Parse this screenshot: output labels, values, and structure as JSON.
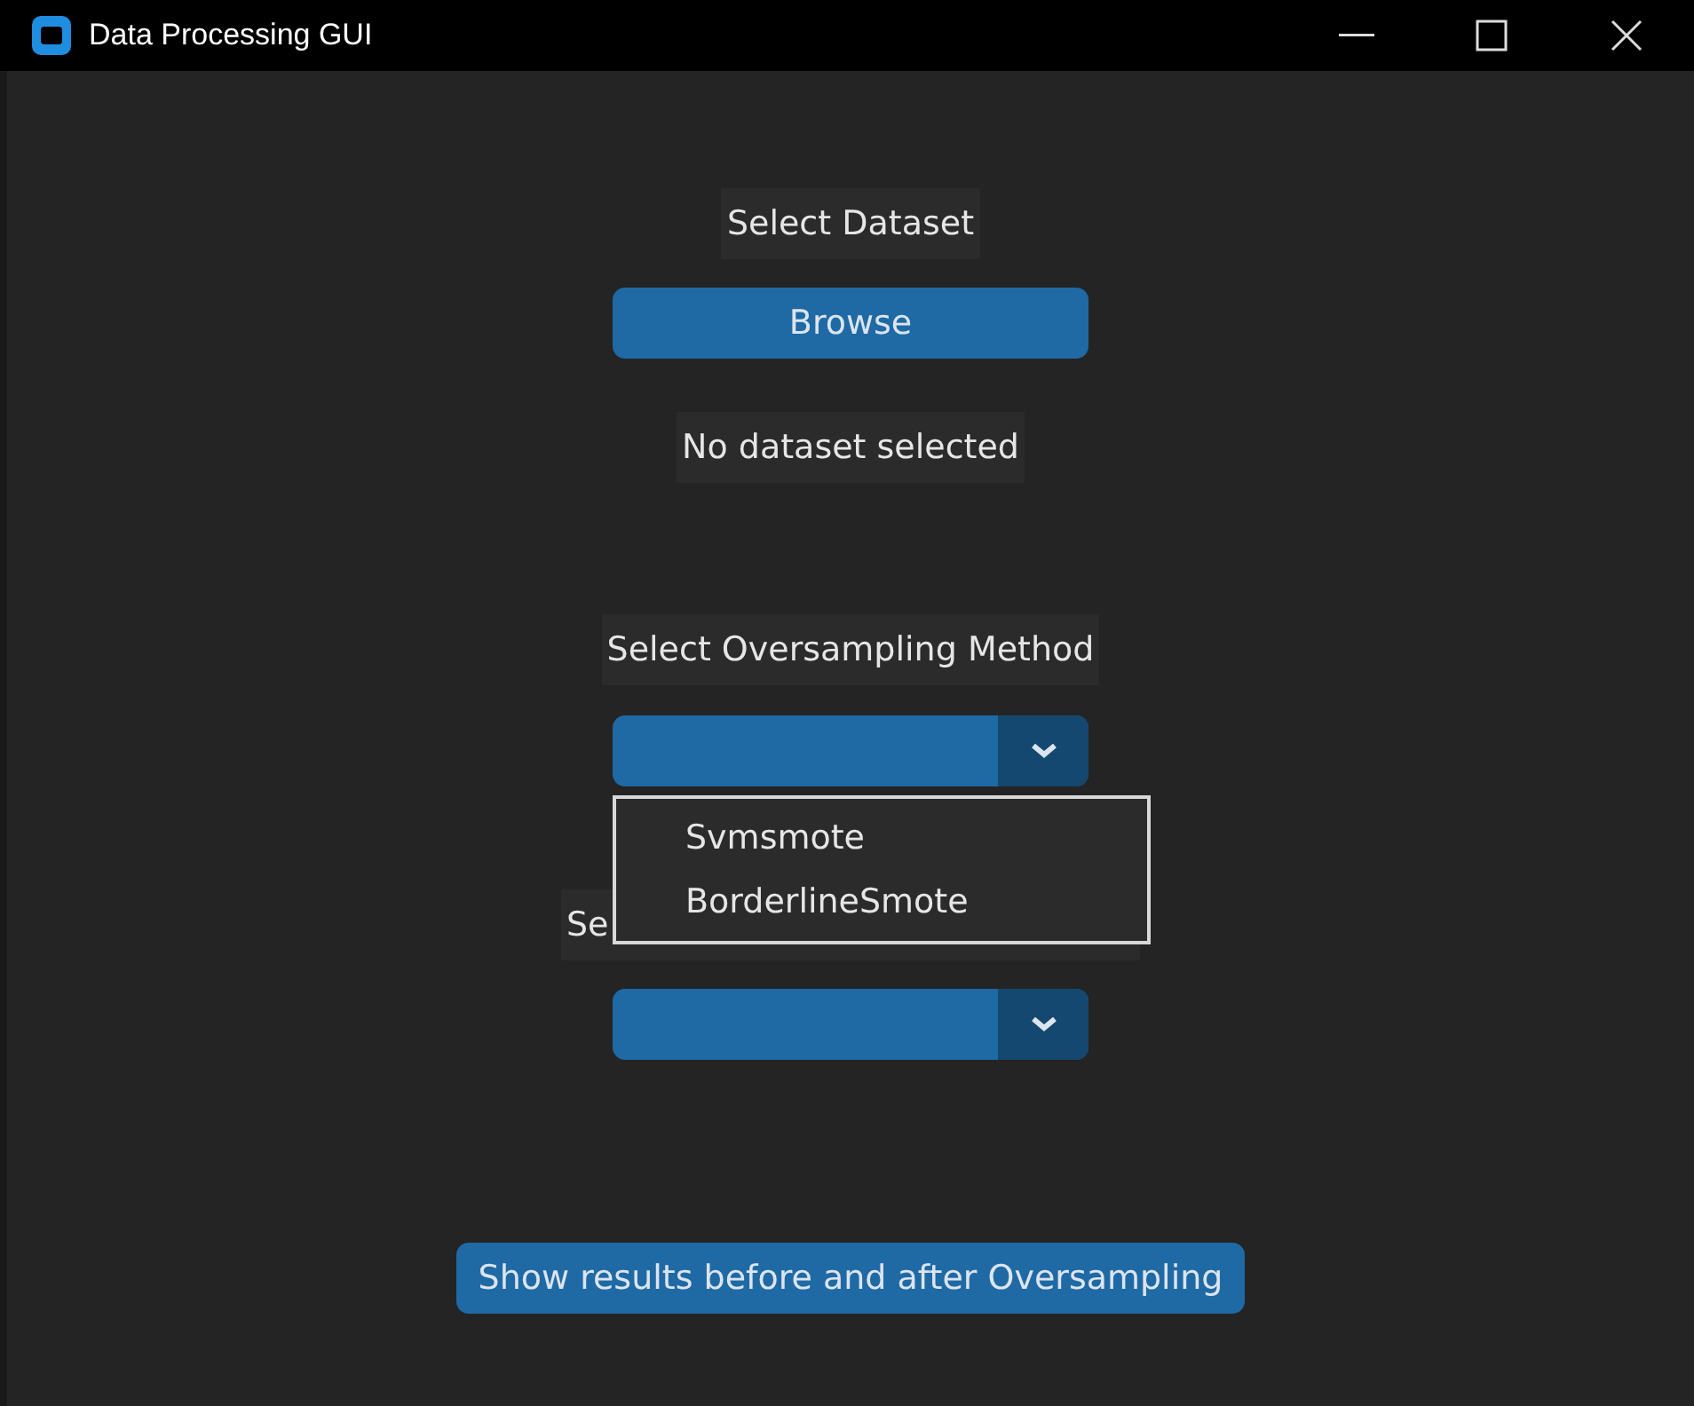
{
  "window": {
    "title": "Data Processing GUI"
  },
  "dataset_label": "Select Dataset",
  "browse_button": "Browse",
  "dataset_status": "No dataset selected",
  "oversampling_label": "Select Oversampling Method",
  "oversampling_dropdown": {
    "open": true,
    "items": [
      "Svmsmote",
      "BorderlineSmote"
    ]
  },
  "classification_label": "Se",
  "results_button": "Show results before and after Oversampling"
}
